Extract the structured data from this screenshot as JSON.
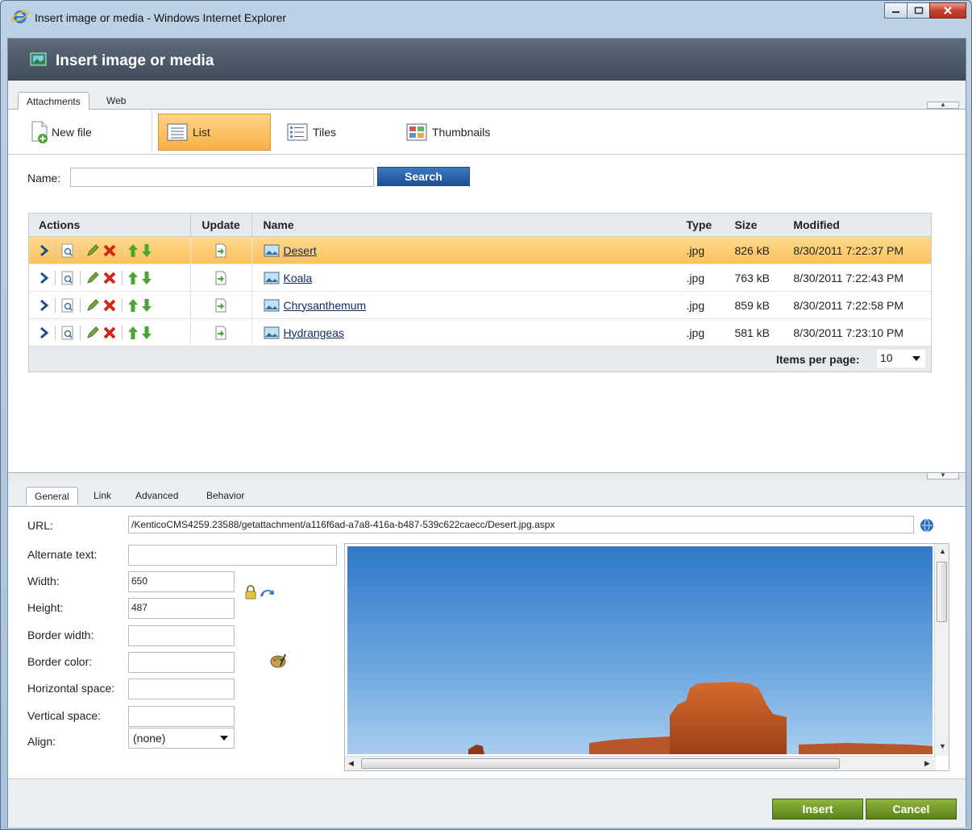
{
  "window": {
    "title": "Insert image or media - Windows Internet Explorer"
  },
  "header": {
    "title": "Insert image or media"
  },
  "top_tabs": [
    {
      "label": "Attachments",
      "active": true
    },
    {
      "label": "Web",
      "active": false
    }
  ],
  "toolbar": {
    "new_file": "New file",
    "list": "List",
    "tiles": "Tiles",
    "thumbnails": "Thumbnails",
    "active_view": "List"
  },
  "search": {
    "name_label": "Name:",
    "name_value": "",
    "button": "Search"
  },
  "grid": {
    "headers": {
      "actions": "Actions",
      "update": "Update",
      "name": "Name",
      "type": "Type",
      "size": "Size",
      "modified": "Modified"
    },
    "rows": [
      {
        "name": "Desert",
        "type": ".jpg",
        "size": "826 kB",
        "modified": "8/30/2011 7:22:37 PM",
        "selected": true
      },
      {
        "name": "Koala",
        "type": ".jpg",
        "size": "763 kB",
        "modified": "8/30/2011 7:22:43 PM",
        "selected": false
      },
      {
        "name": "Chrysanthemum",
        "type": ".jpg",
        "size": "859 kB",
        "modified": "8/30/2011 7:22:58 PM",
        "selected": false
      },
      {
        "name": "Hydrangeas",
        "type": ".jpg",
        "size": "581 kB",
        "modified": "8/30/2011 7:23:10 PM",
        "selected": false
      }
    ],
    "items_per_page_label": "Items per page:",
    "items_per_page_value": "10"
  },
  "bottom_tabs": [
    {
      "label": "General",
      "active": true
    },
    {
      "label": "Link",
      "active": false
    },
    {
      "label": "Advanced",
      "active": false
    },
    {
      "label": "Behavior",
      "active": false
    }
  ],
  "props": {
    "url_label": "URL:",
    "url_value": "/KenticoCMS4259.23588/getattachment/a116f6ad-a7a8-416a-b487-539c622caecc/Desert.jpg.aspx",
    "alt_label": "Alternate text:",
    "alt_value": "",
    "width_label": "Width:",
    "width_value": "650",
    "height_label": "Height:",
    "height_value": "487",
    "border_width_label": "Border width:",
    "border_color_label": "Border color:",
    "hspace_label": "Horizontal space:",
    "vspace_label": "Vertical space:",
    "align_label": "Align:",
    "align_value": "(none)"
  },
  "footer": {
    "insert": "Insert",
    "cancel": "Cancel"
  },
  "colors": {
    "selected_row": "#fbc35b",
    "header_bg": "#4a5765",
    "search_btn": "#2a62ad",
    "action_btn": "#6f9a2a"
  }
}
